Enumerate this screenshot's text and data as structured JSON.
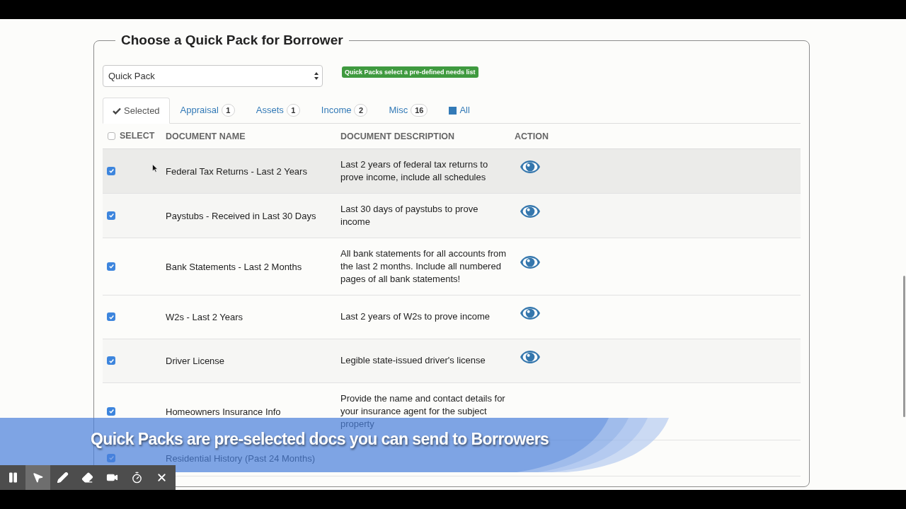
{
  "legend": "Choose a Quick Pack for Borrower",
  "quick_pack_select": {
    "value": "Quick Pack"
  },
  "hint_label": "Quick Packs select a pre-defined needs list",
  "tabs": [
    {
      "kind": "check",
      "label": "Selected",
      "selected": true
    },
    {
      "kind": "count",
      "label": "Appraisal",
      "count": "1",
      "selected": false
    },
    {
      "kind": "count",
      "label": "Assets",
      "count": "1",
      "selected": false
    },
    {
      "kind": "count",
      "label": "Income",
      "count": "2",
      "selected": false
    },
    {
      "kind": "count",
      "label": "Misc",
      "count": "16",
      "selected": false
    },
    {
      "kind": "swatch",
      "label": "All",
      "selected": false
    }
  ],
  "table": {
    "select_all_checked": false,
    "columns": [
      "SELECT",
      "DOCUMENT NAME",
      "DOCUMENT DESCRIPTION",
      "ACTION"
    ],
    "rows": [
      {
        "checked": true,
        "hovered": true,
        "shaded": true,
        "name": "Federal Tax Returns - Last 2 Years",
        "description": "Last 2 years of federal tax returns to prove income, include all schedules",
        "view_icon": true
      },
      {
        "checked": true,
        "hovered": false,
        "shaded": true,
        "name": "Paystubs - Received in Last 30 Days",
        "description": "Last 30 days of paystubs to prove income",
        "view_icon": true
      },
      {
        "checked": true,
        "hovered": false,
        "shaded": false,
        "name": "Bank Statements - Last 2 Months",
        "description": "All bank statements for all accounts from the last 2 months. Include all numbered pages of all bank statements!",
        "view_icon": true
      },
      {
        "checked": true,
        "hovered": false,
        "shaded": false,
        "name": "W2s - Last 2 Years",
        "description": "Last 2 years of W2s to prove income",
        "view_icon": true
      },
      {
        "checked": true,
        "hovered": false,
        "shaded": true,
        "name": "Driver License",
        "description": "Legible state-issued driver's license",
        "view_icon": true
      },
      {
        "checked": true,
        "hovered": false,
        "shaded": false,
        "name": "Homeowners Insurance Info",
        "description": "Provide the name and contact details for your insurance agent for the subject property",
        "view_icon": false
      },
      {
        "checked": true,
        "hovered": false,
        "shaded": false,
        "name": "Residential History (Past 24 Months)",
        "view_icon": false
      }
    ]
  },
  "caption": "Quick Packs are pre-selected docs you can send to Borrowers",
  "recording_toolbar": {
    "tools": [
      {
        "kind": "pause",
        "selected": false
      },
      {
        "kind": "pointer",
        "selected": true
      },
      {
        "kind": "pen",
        "selected": false
      },
      {
        "kind": "eraser",
        "selected": false
      },
      {
        "kind": "camera",
        "selected": false
      },
      {
        "kind": "timer",
        "selected": false
      },
      {
        "kind": "close",
        "selected": false
      }
    ]
  }
}
